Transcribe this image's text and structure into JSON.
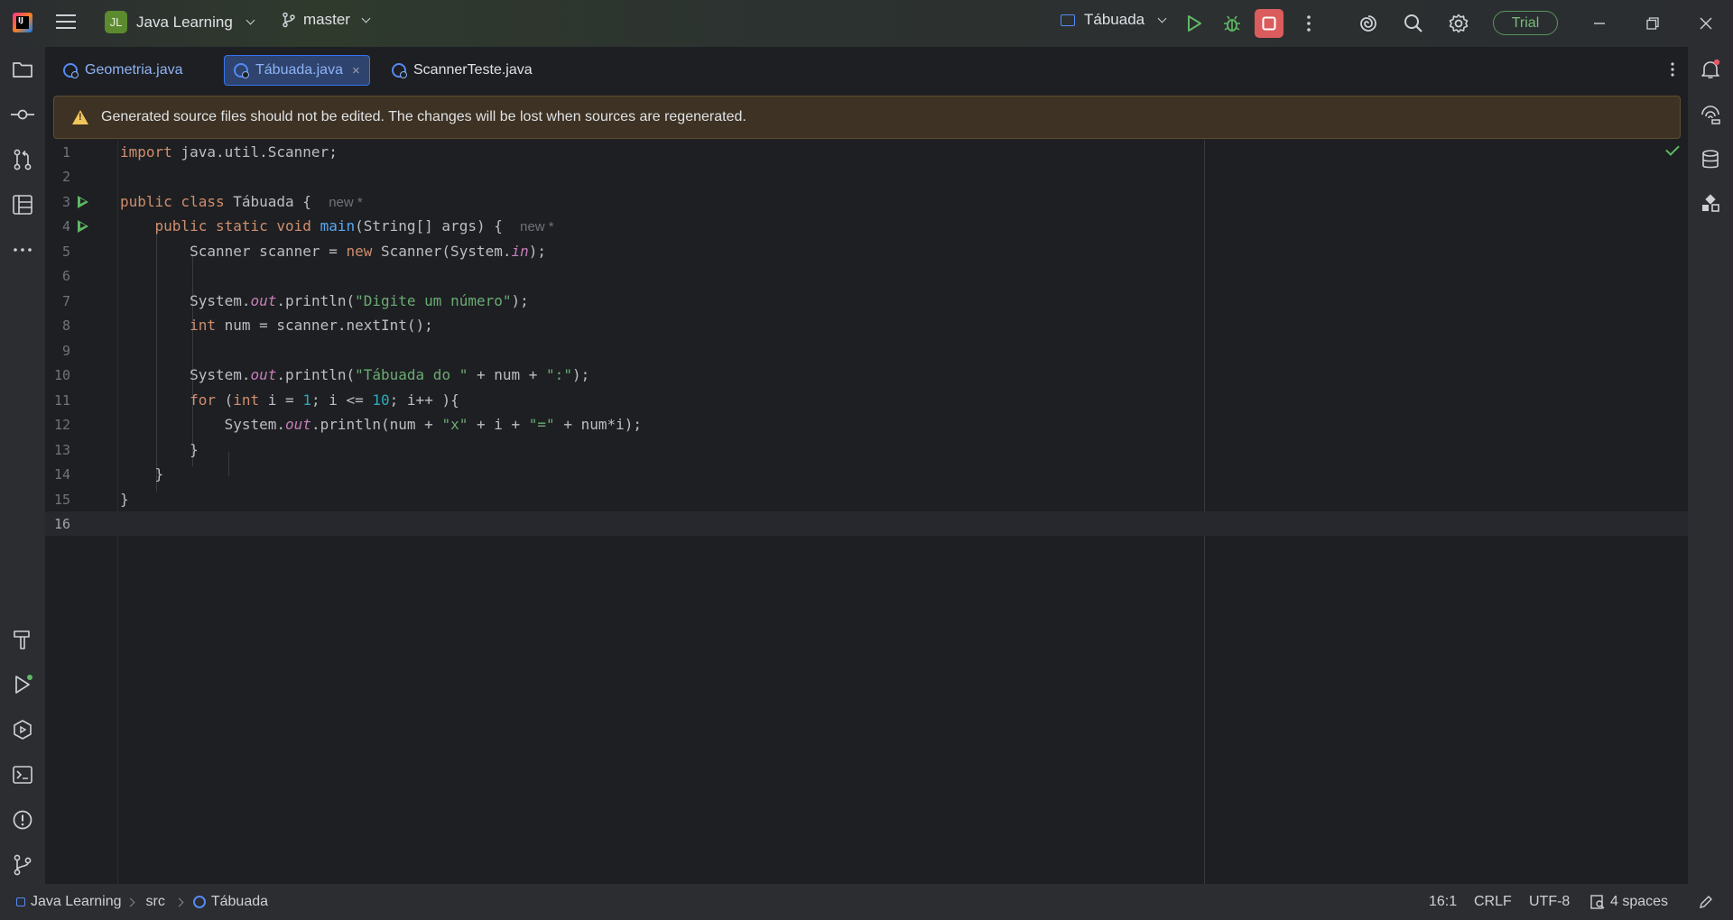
{
  "titlebar": {
    "project_initials": "JL",
    "project_name": "Java Learning",
    "branch": "master",
    "run_config": "Tábuada",
    "trial_label": "Trial"
  },
  "icons": {
    "app_logo": "intellij-logo-icon",
    "menu": "hamburger-menu-icon",
    "run": "run-icon",
    "debug": "debug-bug-icon",
    "stop": "stop-icon",
    "more": "more-vertical-icon",
    "ai": "ai-assistant-spiral-icon",
    "search": "search-icon",
    "settings": "gear-icon",
    "minimize": "minimize-icon",
    "restore": "restore-icon",
    "close": "close-icon"
  },
  "colors": {
    "accent": "#3574f0",
    "run_green": "#5fb865",
    "stop_red": "#db5c5c",
    "warning_bg": "#3d3223",
    "trial_green": "#73bd79"
  },
  "tabs": [
    {
      "label": "Geometria.java",
      "active": false
    },
    {
      "label": "Tábuada.java",
      "active": true,
      "close": "×"
    },
    {
      "label": "ScannerTeste.java",
      "active": false
    }
  ],
  "banner": {
    "text": "Generated source files should not be edited. The changes will be lost when sources are regenerated."
  },
  "editor": {
    "lines": [
      {
        "n": "1"
      },
      {
        "n": "2"
      },
      {
        "n": "3",
        "hint": "new *"
      },
      {
        "n": "4",
        "hint": "new *"
      },
      {
        "n": "5"
      },
      {
        "n": "6"
      },
      {
        "n": "7"
      },
      {
        "n": "8"
      },
      {
        "n": "9"
      },
      {
        "n": "10"
      },
      {
        "n": "11"
      },
      {
        "n": "12"
      },
      {
        "n": "13"
      },
      {
        "n": "14"
      },
      {
        "n": "15"
      },
      {
        "n": "16"
      }
    ],
    "code": {
      "l1_kw": "import",
      "l1_rest": " java.util.Scanner;",
      "l3_kw": "public class",
      "l3_rest": " Tábuada {",
      "l4_kw": "public static void",
      "l4_fn": "main",
      "l4_rest": "(String[] args) {",
      "l5_a": "Scanner scanner = ",
      "l5_kw": "new",
      "l5_b": " Scanner(System.",
      "l5_static": "in",
      "l5_c": ");",
      "l7_a": "System.",
      "l7_static": "out",
      "l7_b": ".println(",
      "l7_str": "\"Digite um número\"",
      "l7_c": ");",
      "l8_kw": "int",
      "l8_rest": " num = scanner.nextInt();",
      "l10_a": "System.",
      "l10_static": "out",
      "l10_b": ".println(",
      "l10_str1": "\"Tábuada do \"",
      "l10_c": " + num + ",
      "l10_str2": "\":\"",
      "l10_d": ");",
      "l11_kw1": "for",
      "l11_a": " (",
      "l11_kw2": "int",
      "l11_b": " i = ",
      "l11_n1": "1",
      "l11_c": "; i <= ",
      "l11_n2": "10",
      "l11_d": "; i++ ){",
      "l12_a": "System.",
      "l12_static": "out",
      "l12_b": ".println(num + ",
      "l12_str1": "\"x\"",
      "l12_c": " + i + ",
      "l12_str2": "\"=\"",
      "l12_d": " + num*i);",
      "l13": "}",
      "l14": "}",
      "l15": "}"
    }
  },
  "statusbar": {
    "crumbs": [
      "Java Learning",
      "src",
      "Tábuada"
    ],
    "position": "16:1",
    "line_sep": "CRLF",
    "encoding": "UTF-8",
    "indent": "4 spaces"
  }
}
